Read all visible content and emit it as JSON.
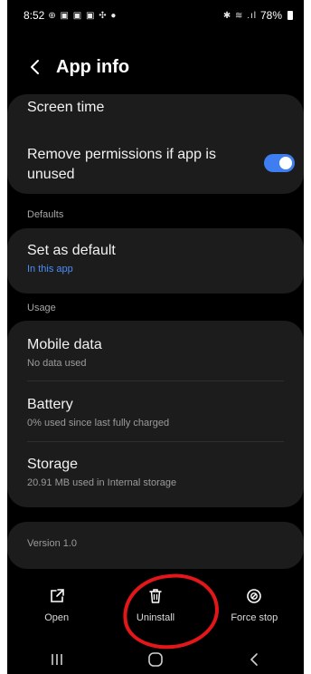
{
  "status_bar": {
    "time": "8:52",
    "notif_icons": "⊕ ▣ ▣ ▣ ✣ ●",
    "signal_icons": "✱ ≋ .ıl",
    "battery": "78%"
  },
  "header": {
    "title": "App info"
  },
  "rows": {
    "screen_time": {
      "title": "Screen time"
    },
    "remove_permissions": {
      "title_line1": "Remove permissions if app is",
      "title_line2": "unused",
      "toggle_on": true
    },
    "defaults_label": "Defaults",
    "set_as_default": {
      "title": "Set as default",
      "subtitle": "In this app"
    },
    "usage_label": "Usage",
    "mobile_data": {
      "title": "Mobile data",
      "subtitle": "No data used"
    },
    "battery": {
      "title": "Battery",
      "subtitle": "0% used since last fully charged"
    },
    "storage": {
      "title": "Storage",
      "subtitle": "20.91 MB used in Internal storage"
    },
    "version": {
      "text": "Version 1.0"
    }
  },
  "actions": [
    {
      "label": "Open",
      "icon": "open-external-icon"
    },
    {
      "label": "Uninstall",
      "icon": "trash-icon"
    },
    {
      "label": "Force stop",
      "icon": "stop-icon"
    }
  ],
  "colors": {
    "accent": "#3e7ef0",
    "annotation": "#e3161a",
    "card": "#1c1c1c"
  }
}
